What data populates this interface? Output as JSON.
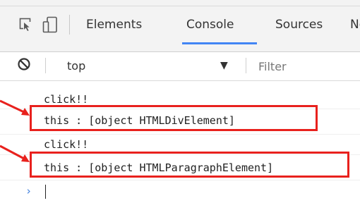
{
  "tabs": {
    "elements": "Elements",
    "console": "Console",
    "sources": "Sources",
    "network": "Network"
  },
  "toolbar": {
    "context": "top",
    "filter_placeholder": "Filter"
  },
  "console": {
    "messages": [
      "click!!",
      "this : [object HTMLDivElement]",
      "click!!",
      "this : [object HTMLParagraphElement]"
    ],
    "prompt": "›"
  },
  "colors": {
    "highlight": "#e8211d",
    "accent": "#4285f4",
    "prompt": "#3b7ddd"
  },
  "icons": [
    "inspect-element-icon",
    "device-toolbar-icon",
    "clear-console-icon",
    "dropdown-caret-icon",
    "prompt-chevron-icon"
  ]
}
